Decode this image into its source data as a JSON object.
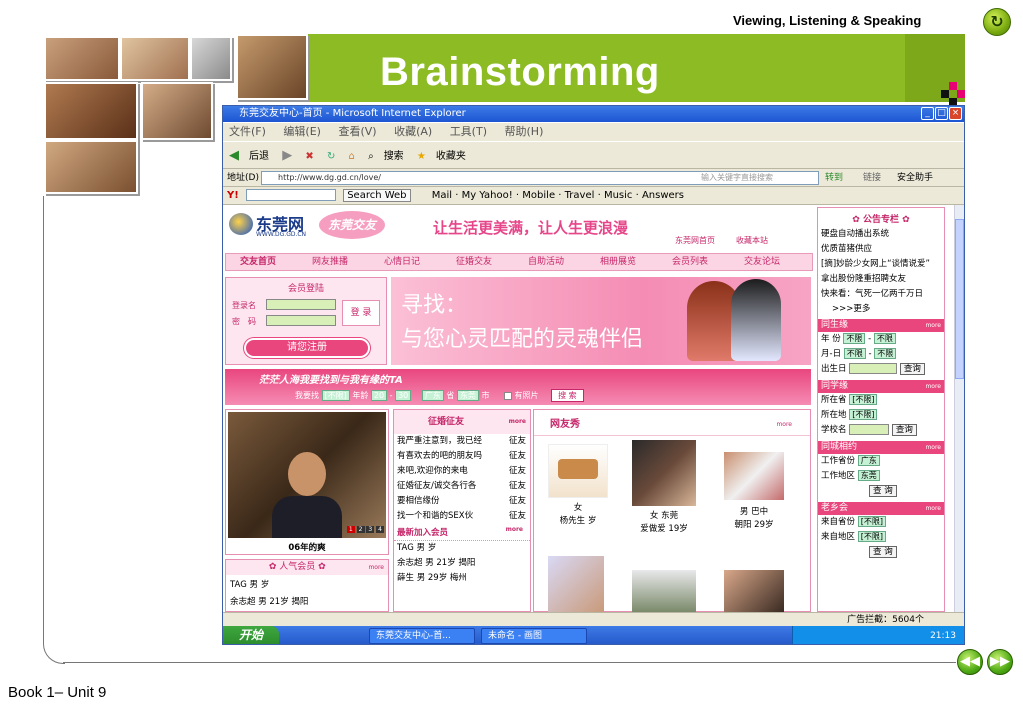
{
  "header": {
    "title": "Viewing, Listening & Speaking"
  },
  "banner": {
    "title": "Brainstorming"
  },
  "footer": {
    "label": "Book 1– Unit 9"
  },
  "colors": {
    "accent_green": "#8cbb24",
    "pink": "#e9467e",
    "xp_blue": "#1d55d2"
  },
  "icons": {
    "refresh": "refresh-icon",
    "prev": "prev-arrow-icon",
    "next": "next-arrow-icon"
  },
  "browser": {
    "window_title": "东莞交友中心-首页 - Microsoft Internet Explorer",
    "menu": [
      "文件(F)",
      "编辑(E)",
      "查看(V)",
      "收藏(A)",
      "工具(T)",
      "帮助(H)"
    ],
    "toolbar": [
      "后退",
      "搜索",
      "收藏夹"
    ],
    "address_label": "地址(D)",
    "address": "http://www.dg.gd.cn/love/",
    "go_label": "转到",
    "links_label": "链接",
    "safe_label": "安全助手",
    "search_hint": "输入关键字直接搜索",
    "yahoo": {
      "search_button": "Search Web",
      "links": [
        "Mail",
        "My Yahoo!",
        "Mobile",
        "Travel",
        "Music",
        "Answers"
      ]
    },
    "status_text": "广告拦截：5604个",
    "taskbar": {
      "start": "开始",
      "tasks": [
        "东莞交友中心-首...",
        "未命名 - 画图"
      ],
      "clock": "21:13"
    }
  },
  "site": {
    "logo": "东莞网",
    "logo_sub": "WWW.DG.GD.CN",
    "logo_badge": "东莞交友",
    "slogan": "让生活更美满，让人生更浪漫",
    "top_links": [
      "东莞网首页",
      "收藏本站"
    ],
    "nav": [
      "交友首页",
      "网友推播",
      "心情日记",
      "征婚交友",
      "自助活动",
      "相册展览",
      "会员列表",
      "交友论坛"
    ],
    "login": {
      "title": "会员登陆",
      "user_label": "登录名",
      "pass_label": "密　码",
      "login_button": "登 录",
      "register_button": "请您注册"
    },
    "hero_line1": "寻找：",
    "hero_line2": "与您心灵匹配的灵魂伴侣",
    "search": {
      "title": "茫茫人海我要找到与我有缘的TA",
      "label": "我要找",
      "any": "[不限]",
      "age_label": "年龄",
      "age_from": "20",
      "age_to": "30",
      "province": "广东",
      "province_suffix": "省",
      "city": "东莞",
      "city_suffix": "市",
      "photo_label": "有照片",
      "button": "搜 索"
    },
    "photo_caption": "06年的爽",
    "pager": [
      "1",
      "2",
      "3",
      "4"
    ],
    "popular": {
      "title": "人气会员",
      "more": "more",
      "items": [
        "TAG 男 岁",
        "余志超 男 21岁 揭阳"
      ]
    },
    "marriage": {
      "title": "征婚征友",
      "more": "more",
      "items": [
        {
          "text": "我严重注意到，我已经",
          "tag": "征友"
        },
        {
          "text": "有喜欢去的吧的朋友吗",
          "tag": "征友"
        },
        {
          "text": "来吧,欢迎你的来电",
          "tag": "征友"
        },
        {
          "text": "征婚征友/诚交各行各",
          "tag": "征友"
        },
        {
          "text": "要相信缘份",
          "tag": "征友"
        },
        {
          "text": "找一个和谐的SEX伙",
          "tag": "征友"
        }
      ]
    },
    "new_members": {
      "title": "最新加入会员",
      "more": "more",
      "items": [
        "TAG 男 岁",
        "余志超 男 21岁 揭阳",
        "薛生 男 29岁 梅州"
      ]
    },
    "netfriends": {
      "title": "网友秀",
      "more": "more",
      "cards": [
        {
          "line1": "女",
          "line2": "杨先生 岁"
        },
        {
          "line1": "女 东莞",
          "line2": "爱做爱 19岁"
        },
        {
          "line1": "男 巴中",
          "line2": "朝阳 29岁"
        }
      ]
    },
    "sidebar": {
      "notice_title": "公告专栏",
      "notices": [
        "硬盘自动播出系统",
        "优质苗猪供应",
        "[摘]妙龄少女网上“谈情说爱”",
        "拿出股份隆重招聘女友",
        "快来看：气死一亿两千万日"
      ],
      "notice_more": ">>>更多",
      "birthday": {
        "title": "同生缘",
        "more": "more",
        "year_label": "年 份",
        "month_label": "月-日",
        "date_label": "出生日",
        "any": "不限",
        "query": "查询"
      },
      "classmate": {
        "title": "同学缘",
        "more": "more",
        "province_label": "所在省",
        "city_label": "所在地",
        "school_label": "学校名",
        "any": "[不限]",
        "query": "查询"
      },
      "city": {
        "title": "同城相约",
        "more": "more",
        "province_label": "工作省份",
        "area_label": "工作地区",
        "province": "广东",
        "area": "东莞",
        "query": "查 询"
      },
      "hometown": {
        "title": "老乡会",
        "more": "more",
        "province_label": "来自省份",
        "area_label": "来自地区",
        "any": "[不限]",
        "query": "查 询"
      }
    }
  }
}
